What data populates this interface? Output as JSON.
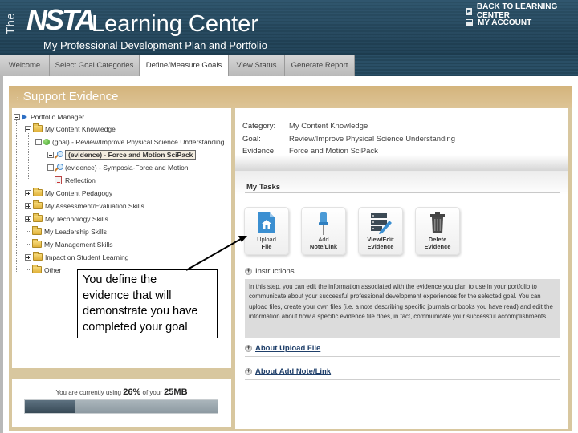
{
  "header": {
    "logo_the": "The",
    "logo_brand": "NSTA",
    "logo_title": "Learning Center",
    "subtitle": "My Professional Development Plan and Portfolio",
    "links": [
      {
        "label": "BACK TO LEARNING CENTER",
        "icon": "arrow-right-icon"
      },
      {
        "label": "MY ACCOUNT",
        "icon": "account-icon"
      }
    ]
  },
  "tabs": [
    {
      "label": "Welcome",
      "active": false
    },
    {
      "label": "Select Goal Categories",
      "active": false
    },
    {
      "label": "Define/Measure Goals",
      "active": true
    },
    {
      "label": "View Status",
      "active": false
    },
    {
      "label": "Generate Report",
      "active": false
    }
  ],
  "panel": {
    "title": "Support Evidence"
  },
  "tree": {
    "root": "Portfolio Manager",
    "items": [
      {
        "label": "My Content Knowledge",
        "type": "folder",
        "expander": "minus"
      },
      {
        "label": "(goal) - Review/Improve Physical Science Understanding",
        "type": "goal"
      },
      {
        "label": "(evidence) - Force and Motion SciPack",
        "type": "evidence",
        "selected": true
      },
      {
        "label": "(evidence) - Symposia-Force and Motion",
        "type": "evidence",
        "selected": false
      },
      {
        "label": "Reflection",
        "type": "reflection"
      },
      {
        "label": "My Content Pedagogy",
        "type": "folder",
        "expander": "plus"
      },
      {
        "label": "My Assessment/Evaluation Skills",
        "type": "folder",
        "expander": "plus"
      },
      {
        "label": "My Technology Skills",
        "type": "folder",
        "expander": "plus"
      },
      {
        "label": "My Leadership Skills",
        "type": "folder",
        "expander": "none"
      },
      {
        "label": "My Management Skills",
        "type": "folder",
        "expander": "none"
      },
      {
        "label": "Impact on Student Learning",
        "type": "folder",
        "expander": "plus"
      },
      {
        "label": "Other",
        "type": "folder",
        "expander": "none"
      }
    ]
  },
  "callout": {
    "lines": [
      "You define the",
      "evidence that will",
      "demonstrate you have",
      "completed your goal"
    ]
  },
  "storage": {
    "prefix": "You are currently using ",
    "percent_label": "26%",
    "middle": " of your ",
    "quota_label": "25MB",
    "used_fraction": 0.26
  },
  "details": {
    "category_label": "Category:",
    "category_value": "My Content Knowledge",
    "goal_label": "Goal:",
    "goal_value": "Review/Improve Physical Science Understanding",
    "evidence_label": "Evidence:",
    "evidence_value": "Force and Motion SciPack"
  },
  "tasks": {
    "title": "My Tasks",
    "buttons": [
      {
        "line1": "Upload",
        "line2": "File",
        "icon": "upload-file-icon"
      },
      {
        "line1": "Add",
        "line2": "Note/Link",
        "icon": "pushpin-icon"
      },
      {
        "line1": "View/Edit",
        "line2": "Evidence",
        "icon": "edit-list-icon"
      },
      {
        "line1": "Delete",
        "line2": "Evidence",
        "icon": "trash-icon"
      }
    ]
  },
  "instructions": {
    "heading": "Instructions",
    "text": "In this step, you can edit the information associated with the evidence you plan to use in your portfolio to communicate about your successful professional development experiences for the selected goal. You can upload files, create your own files (i.e. a note describing specific journals or books you have read) and edit the information about how a specific evidence file does, in fact, communicate your successful accomplishments."
  },
  "help_links": [
    {
      "label": "About Upload File"
    },
    {
      "label": "About Add Note/Link"
    }
  ],
  "colors": {
    "header_bg": "#264b61",
    "frame_tan": "#d8c79f",
    "title_bar": "#d4b47c",
    "link_blue": "#1f3f6a",
    "storage_fill": "#384a57"
  }
}
